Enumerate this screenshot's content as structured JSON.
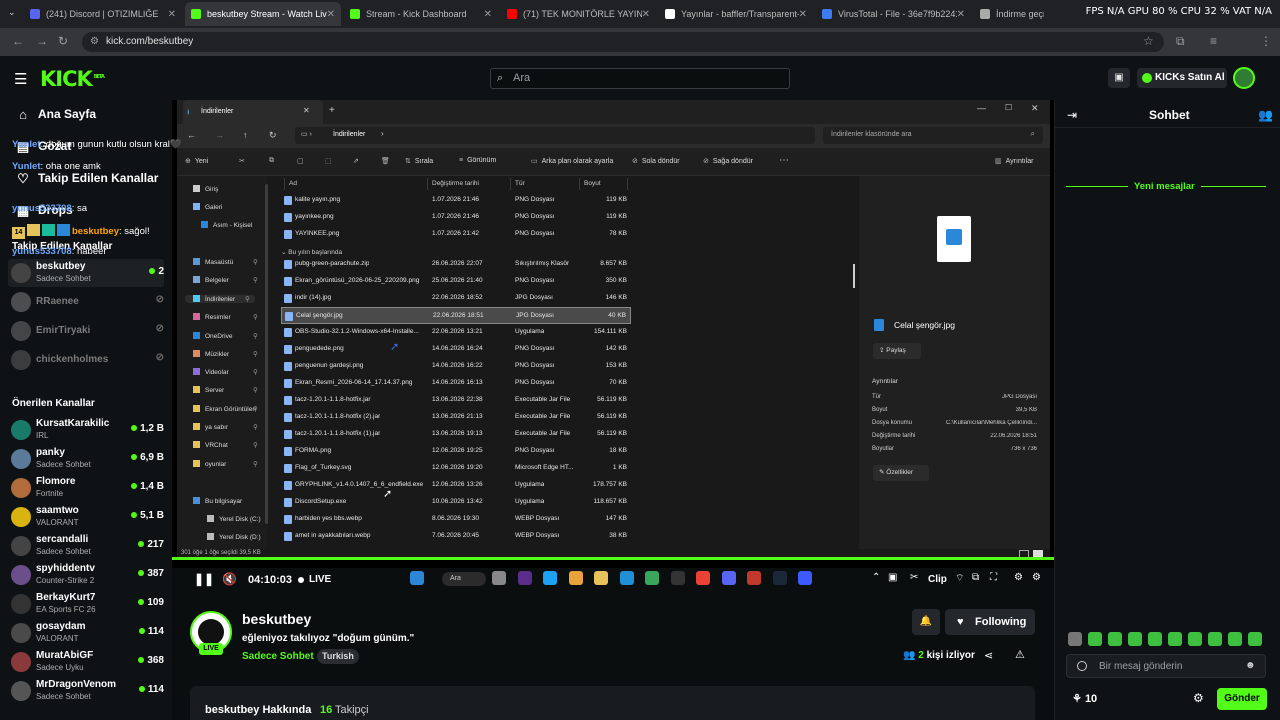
{
  "browser": {
    "tabs": [
      {
        "label": "(241) Discord | OTIZIMLIĞE",
        "active": false,
        "color": "#5865f2"
      },
      {
        "label": "beskutbey Stream - Watch Live",
        "active": true,
        "color": "#53fc18"
      },
      {
        "label": "Stream - Kick Dashboard",
        "active": false,
        "color": "#53fc18"
      },
      {
        "label": "(71) TEK MONITÖRLE YAYIN YA",
        "active": false,
        "color": "#ff0000"
      },
      {
        "label": "Yayınlar - baffler/Transparent-T",
        "active": false,
        "color": "#ffffff"
      },
      {
        "label": "VirusTotal - File - 36e7f9b2241d",
        "active": false,
        "color": "#3d7cf4"
      },
      {
        "label": "İndirme geçmişi",
        "active": false,
        "color": "#aaaaaa"
      }
    ],
    "overlay_stats": "FPS N/A  GPU 80 %  CPU 32 %  VAT N/A",
    "url": "kick.com/beskutbey"
  },
  "header": {
    "logo": "KICK",
    "logo_sup": "BETA",
    "search_placeholder": "Ara",
    "kicks_button": "KICKs Satın Al"
  },
  "sidebar": {
    "nav": [
      {
        "label": "Ana Sayfa",
        "icon": "home-icon"
      },
      {
        "label": "Gözat",
        "icon": "browse-icon"
      },
      {
        "label": "Takip Edilen Kanallar",
        "icon": "heart-icon"
      },
      {
        "label": "Drops",
        "icon": "drops-icon"
      }
    ],
    "followed_title": "Takip Edilen Kanallar",
    "followed": [
      {
        "name": "beskutbey",
        "sub": "Sadece Sohbet",
        "count": "2",
        "live": true
      },
      {
        "name": "RRaenee",
        "sub": "",
        "count": "",
        "live": false
      },
      {
        "name": "EmirTiryaki",
        "sub": "",
        "count": "",
        "live": false
      },
      {
        "name": "chickenholmes",
        "sub": "",
        "count": "",
        "live": false
      }
    ],
    "recommended_title": "Önerilen Kanallar",
    "recommended": [
      {
        "name": "KursatKarakilic",
        "sub": "IRL",
        "count": "1,2 B"
      },
      {
        "name": "panky",
        "sub": "Sadece Sohbet",
        "count": "6,9 B"
      },
      {
        "name": "Flomore",
        "sub": "Fortnite",
        "count": "1,4 B"
      },
      {
        "name": "saamtwo",
        "sub": "VALORANT",
        "count": "5,1 B"
      },
      {
        "name": "sercandalli",
        "sub": "Sadece Sohbet",
        "count": "217"
      },
      {
        "name": "spyhiddentv",
        "sub": "Counter-Strike 2",
        "count": "387"
      },
      {
        "name": "BerkayKurt7",
        "sub": "EA Sports FC 26",
        "count": "109"
      },
      {
        "name": "gosaydam",
        "sub": "VALORANT",
        "count": "114"
      },
      {
        "name": "MuratAbiGF",
        "sub": "Sadece Uyku",
        "count": "368"
      },
      {
        "name": "MrDragonVenom",
        "sub": "Sadece Sohbet",
        "count": "114"
      }
    ]
  },
  "explorer": {
    "window_title": "İndirilenler",
    "path": "İndirilenler",
    "search_placeholder": "İndirilenler klasöründe ara",
    "toolbar": [
      "Yeni",
      "Sırala",
      "Görünüm",
      "Arka plan olarak ayarla",
      "Sola döndür",
      "Sağa döndür",
      "Ayrıntılar"
    ],
    "nav_items": [
      "Giriş",
      "Galeri",
      "Asım - Kişisel",
      "Masaüstü",
      "Belgeler",
      "İndirilenler",
      "Resimler",
      "OneDrive",
      "Müzikler",
      "Videolar",
      "Server",
      "Ekran Görüntüleri",
      "ya sabır",
      "VRChat",
      "oyunlar",
      "Bu bilgisayar",
      "Yerel Disk (C:)",
      "Yerel Disk (D:)"
    ],
    "columns": [
      "Ad",
      "Değiştirme tarihi",
      "Tür",
      "Boyut"
    ],
    "group_label": "Bu yılın başlarında",
    "files_top": [
      [
        "kalite yayın.png",
        "1.07.2026 21:46",
        "PNG Dosyası",
        "119 KB"
      ],
      [
        "yayınkee.png",
        "1.07.2026 21:46",
        "PNG Dosyası",
        "119 KB"
      ],
      [
        "YAYINKEE.png",
        "1.07.2026 21:42",
        "PNG Dosyası",
        "78 KB"
      ]
    ],
    "files": [
      [
        "pubg-green-parachute.zip",
        "26.06.2026 22:07",
        "Sıkıştırılmış Klasör",
        "8.657 KB"
      ],
      [
        "Ekran_görüntüsü_2026-06-25_220209.png",
        "25.06.2026 21:40",
        "PNG Dosyası",
        "350 KB"
      ],
      [
        "indir (14).jpg",
        "22.06.2026 18:52",
        "JPG Dosyası",
        "146 KB"
      ],
      [
        "Celal şengör.jpg",
        "22.06.2026 18:51",
        "JPG Dosyası",
        "40 KB"
      ],
      [
        "OBS-Studio-32.1.2-Windows-x64-Installe...",
        "22.06.2026 13:21",
        "Uygulama",
        "154.111 KB"
      ],
      [
        "penguedede.png",
        "14.06.2026 16:24",
        "PNG Dosyası",
        "142 KB"
      ],
      [
        "penguenun gardeşi.png",
        "14.06.2026 16:22",
        "PNG Dosyası",
        "153 KB"
      ],
      [
        "Ekran_Resmi_2026-06-14_17.14.37.png",
        "14.06.2026 16:13",
        "PNG Dosyası",
        "70 KB"
      ],
      [
        "tacz-1.20.1-1.1.8-hotfix.jar",
        "13.06.2026 22:38",
        "Executable Jar File",
        "56.119 KB"
      ],
      [
        "tacz-1.20.1-1.1.8-hotfix (2).jar",
        "13.06.2026 21:13",
        "Executable Jar File",
        "56.119 KB"
      ],
      [
        "tacz-1.20.1-1.1.8-hotfix (1).jar",
        "13.06.2026 19:13",
        "Executable Jar File",
        "56.119 KB"
      ],
      [
        "FORMA.png",
        "12.06.2026 19:25",
        "PNG Dosyası",
        "18 KB"
      ],
      [
        "Flag_of_Turkey.svg",
        "12.06.2026 19:20",
        "Microsoft Edge HT...",
        "1 KB"
      ],
      [
        "GRYPHLINK_v1.4.0.1407_6_6_endfield.exe",
        "12.06.2026 13:26",
        "Uygulama",
        "178.757 KB"
      ],
      [
        "DiscordSetup.exe",
        "10.06.2026 13:42",
        "Uygulama",
        "118.657 KB"
      ],
      [
        "harbiden yes bbs.webp",
        "8.06.2026 19:30",
        "WEBP Dosyası",
        "147 KB"
      ],
      [
        "amet in ayakkabıları.webp",
        "7.06.2026 20:45",
        "WEBP Dosyası",
        "38 KB"
      ]
    ],
    "details": {
      "filename": "Celal şengör.jpg",
      "share": "Paylaş",
      "section": "Ayrıntılar",
      "rows": [
        [
          "Tür",
          "JPG Dosyası"
        ],
        [
          "Boyut",
          "39,5 KB"
        ],
        [
          "Dosya konumu",
          "C:\\Kullanıcılar\\Mehlika Çelik\\İndi..."
        ],
        [
          "Değiştirme tarihi",
          "22.06.2026 18:51"
        ],
        [
          "Boyutlar",
          "736 x 736"
        ]
      ],
      "props": "Özellikler"
    },
    "status": "301 öğe   1 öğe seçildi  39,5 KB"
  },
  "player": {
    "time": "04:10:03",
    "live": "LIVE",
    "clip": "Clip"
  },
  "stream": {
    "channel": "beskutbey",
    "title": "eğleniyoz takılıyoz \"doğum günüm.\"",
    "category": "Sadece Sohbet",
    "tag": "Turkish",
    "live_badge": "LIVE",
    "viewers": "2",
    "viewers_label": "kişi izliyor",
    "follow": "Following",
    "about_label": "beskutbey Hakkında",
    "followers": "16",
    "followers_label": "Takipçi"
  },
  "chat": {
    "title": "Sohbet",
    "messages_before": [
      {
        "user": "Yunlet",
        "text": ": doğum gunun kutlu olsun kral🖤"
      },
      {
        "user": "Yunlet",
        "text": ": oha one amk"
      }
    ],
    "new_label": "Yeni mesajlar",
    "messages_after": [
      {
        "user": "yunus533708",
        "text": ": sa"
      },
      {
        "user": "beskutbey",
        "text": ": sağol!"
      },
      {
        "user": "yunus533708",
        "text": ": nabeer"
      }
    ],
    "badge_number": "14",
    "input_placeholder": "Bir mesaj gönderin",
    "points": "10",
    "send": "Gönder"
  },
  "colors": {
    "accent": "#53fc18",
    "user_blue": "#6fa8ff",
    "user_orange": "#ffa500"
  }
}
